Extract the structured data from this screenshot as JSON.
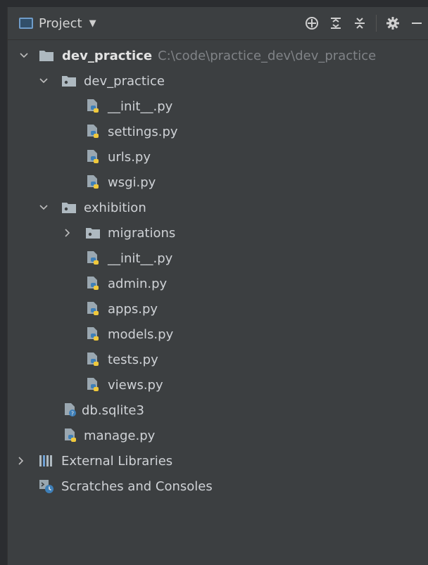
{
  "toolbar": {
    "title": "Project",
    "icons": [
      "project-view-icon",
      "chevron-down-icon",
      "locate-icon",
      "expand-all-icon",
      "collapse-all-icon",
      "gear-icon",
      "hide-icon"
    ]
  },
  "tree": {
    "root": {
      "name": "dev_practice",
      "path": "C:\\code\\practice_dev\\dev_practice"
    },
    "pkg1": {
      "name": "dev_practice",
      "files": [
        "__init__.py",
        "settings.py",
        "urls.py",
        "wsgi.py"
      ]
    },
    "pkg2": {
      "name": "exhibition",
      "sub": "migrations",
      "files": [
        "__init__.py",
        "admin.py",
        "apps.py",
        "models.py",
        "tests.py",
        "views.py"
      ]
    },
    "root_files": [
      "db.sqlite3",
      "manage.py"
    ],
    "external": "External Libraries",
    "scratches": "Scratches and Consoles"
  },
  "colors": {
    "background": "#3c3f41",
    "text": "#cfd2d6",
    "path": "#808387",
    "folder": "#aeb9c0"
  }
}
